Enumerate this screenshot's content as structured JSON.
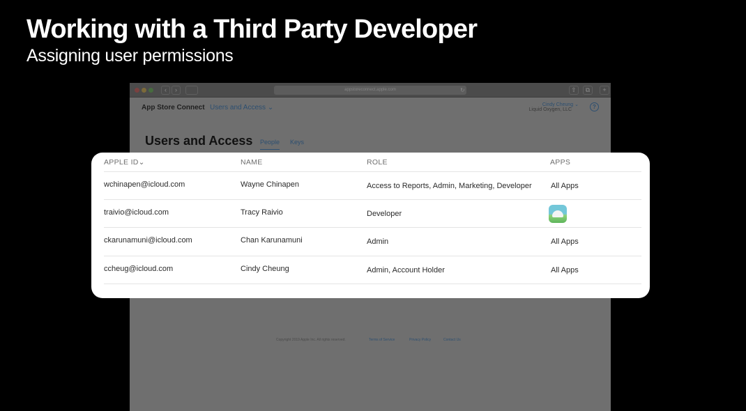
{
  "slide": {
    "title": "Working with a Third Party Developer",
    "subtitle": "Assigning user permissions"
  },
  "browser": {
    "address": "appstoreconnect.apple.com",
    "back_glyph": "‹",
    "forward_glyph": "›"
  },
  "app": {
    "nav_title": "App Store Connect",
    "nav_menu": "Users and Access ⌄",
    "account_name": "Cindy Cheung ⌄",
    "account_org": "Liquid Oxygen, LLC",
    "help_glyph": "?",
    "page_heading": "Users and Access",
    "tabs": [
      {
        "label": "People",
        "selected": true
      },
      {
        "label": "Keys",
        "selected": false
      }
    ],
    "footer": {
      "copyright": "Copyright 2019 Apple Inc. All rights reserved.",
      "links": [
        "Terms of Service",
        "Privacy Policy",
        "Contact Us"
      ]
    }
  },
  "table": {
    "headers": {
      "apple_id": "APPLE ID⌄",
      "name": "NAME",
      "role": "ROLE",
      "apps": "APPS"
    },
    "rows": [
      {
        "apple_id": "wchinapen@icloud.com",
        "name": "Wayne Chinapen",
        "role": "Access to Reports, Admin, Marketing, Developer",
        "apps": "All Apps"
      },
      {
        "apple_id": "traivio@icloud.com",
        "name": "Tracy Raivio",
        "role": "Developer",
        "apps": "",
        "app_icon": "weather-app-icon"
      },
      {
        "apple_id": "ckarunamuni@icloud.com",
        "name": "Chan Karunamuni",
        "role": "Admin",
        "apps": "All Apps"
      },
      {
        "apple_id": "ccheug@icloud.com",
        "name": "Cindy Cheung",
        "role": "Admin, Account Holder",
        "apps": "All Apps"
      }
    ]
  },
  "colors": {
    "background": "#000000",
    "card": "#ffffff",
    "link_blue": "#2d4f70"
  }
}
